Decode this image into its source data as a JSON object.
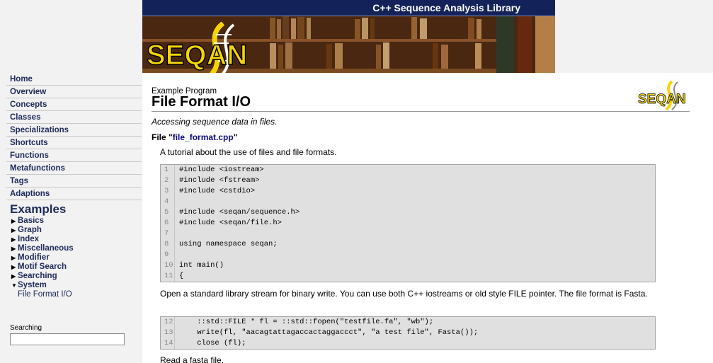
{
  "header": {
    "title": "C++ Sequence Analysis Library",
    "logo_text": "SEQAN"
  },
  "sidebar": {
    "nav": [
      "Home",
      "Overview",
      "Concepts",
      "Classes",
      "Specializations",
      "Shortcuts",
      "Functions",
      "Metafunctions",
      "Tags",
      "Adaptions"
    ],
    "examples_heading": "Examples",
    "examples": [
      "Basics",
      "Graph",
      "Index",
      "Miscellaneous",
      "Modifier",
      "Motif Search",
      "Searching",
      "System"
    ],
    "examples_expanded": "System",
    "system_sub": "File Format I/O",
    "search_label": "Searching",
    "search_value": ""
  },
  "main": {
    "subtitle": "Example Program",
    "title": "File Format I/O",
    "intro": "Accessing sequence data in files.",
    "file_prefix": "File \"",
    "file_name": "file_format.cpp",
    "file_suffix": "\"",
    "para1": "A tutorial about the use of files and file formats.",
    "code1": [
      {
        "n": "1",
        "t": "#include <iostream>"
      },
      {
        "n": "2",
        "t": "#include <fstream>"
      },
      {
        "n": "3",
        "t": "#include <cstdio>"
      },
      {
        "n": "4",
        "t": ""
      },
      {
        "n": "5",
        "t": "#include <seqan/sequence.h>"
      },
      {
        "n": "6",
        "t": "#include <seqan/file.h>"
      },
      {
        "n": "7",
        "t": ""
      },
      {
        "n": "8",
        "t": "using namespace seqan;"
      },
      {
        "n": "9",
        "t": ""
      },
      {
        "n": "10",
        "t": "int main()"
      },
      {
        "n": "11",
        "t": "{"
      }
    ],
    "para2": "Open a standard library stream for binary write. You can use both C++ iostreams or old style FILE pointer. The file format is Fasta.",
    "code2": [
      {
        "n": "12",
        "t": "    ::std::FILE * fl = ::std::fopen(\"testfile.fa\", \"wb\");"
      },
      {
        "n": "13",
        "t": "    write(fl, \"aacagtattagaccactaggaccct\", \"a test file\", Fasta());"
      },
      {
        "n": "14",
        "t": "    close (fl);"
      }
    ],
    "para3": "Read a fasta file."
  },
  "colors": {
    "banner_bar": "#13235a",
    "nav_text": "#1c2a5a",
    "logo_yellow": "#f5d400"
  }
}
